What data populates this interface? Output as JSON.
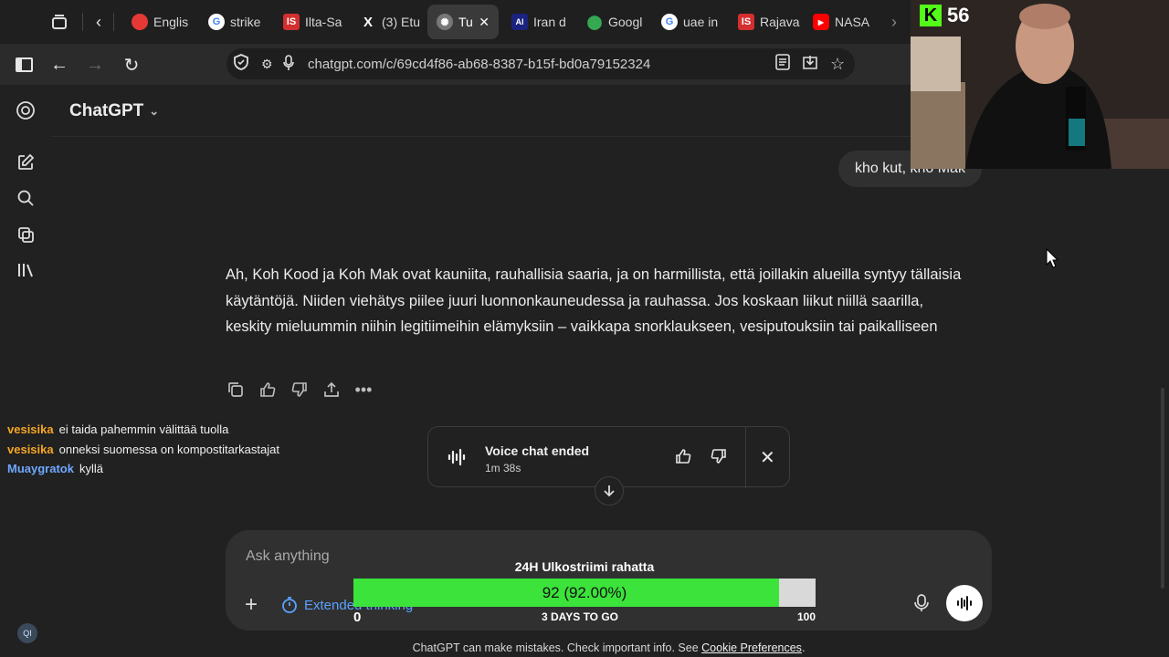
{
  "browser": {
    "tabs": [
      {
        "label": "Englis",
        "icon": "red-circle-icon",
        "color": "#e53935"
      },
      {
        "label": "strike",
        "icon": "google-icon",
        "color": "#ffffff"
      },
      {
        "label": "Ilta-Sa",
        "icon": "is-logo-icon",
        "color": "#d32f2f"
      },
      {
        "label": "(3) Etu",
        "icon": "x-logo-icon",
        "color": "#000000"
      },
      {
        "label": "Tu",
        "icon": "chatgpt-icon",
        "color": "#9e9e9e"
      },
      {
        "label": "Iran d",
        "icon": "news-icon",
        "color": "#1a237e"
      },
      {
        "label": "Googl",
        "icon": "maps-pin-icon",
        "color": "#34a853"
      },
      {
        "label": "uae in",
        "icon": "google-icon",
        "color": "#ffffff"
      },
      {
        "label": "Rajava",
        "icon": "is-logo-icon",
        "color": "#d32f2f"
      },
      {
        "label": "NASA",
        "icon": "youtube-icon",
        "color": "#ff0000"
      }
    ],
    "url": "chatgpt.com/c/69cd4f86-ab68-8387-b15f-bd0a79152324"
  },
  "chatgpt": {
    "title": "ChatGPT",
    "user_message": "kho kut, kho Mak",
    "assistant_message": "Ah, Koh Kood ja Koh Mak ovat kauniita, rauhallisia saaria, ja on harmillista, että joillakin alueilla syntyy tällaisia käytäntöjä. Niiden viehätys piilee juuri luonnonkauneudessa ja rauhassa. Jos koskaan liikut niillä saarilla, keskity mieluummin niihin legitiimeihin elämyksiin – vaikkapa snorklaukseen, vesiputouksiin tai paikalliseen",
    "voice_panel": {
      "title": "Voice chat ended",
      "duration": "1m 38s"
    },
    "composer": {
      "placeholder": "Ask anything",
      "extended_thinking": "Extended thinking"
    },
    "disclaimer": "ChatGPT can make mistakes. Check important info. See",
    "disclaimer_link": "Cookie Preferences",
    "disclaimer_end": ".",
    "avatar_initials": "QI"
  },
  "stream": {
    "platform": "K",
    "viewers": "56",
    "chat": [
      {
        "user": "vesisika",
        "text": "ei taida pahemmin välittää tuolla",
        "color": "#f5a623"
      },
      {
        "user": "vesisika",
        "text": "onneksi suomessa on kompostitarkastajat",
        "color": "#f5a623"
      },
      {
        "user": "Muaygratok",
        "text": "kyllä",
        "color": "#6fa8ff"
      }
    ],
    "goal": {
      "title": "24H Ulkostriimi rahatta",
      "value_text": "92 (92.00%)",
      "progress": 0.92,
      "min": "0",
      "max": "100",
      "subtitle": "3 DAYS TO GO"
    }
  }
}
